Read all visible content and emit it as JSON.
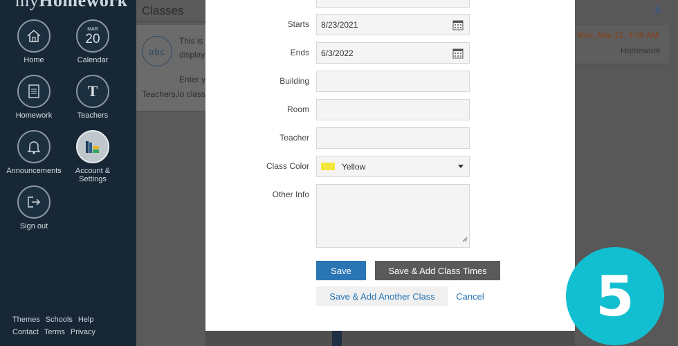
{
  "sidebar": {
    "brand_light": "my",
    "brand_bold": "Homework",
    "nav": [
      {
        "label": "Home",
        "icon": "home-icon"
      },
      {
        "label": "Calendar",
        "icon": "calendar-icon",
        "month": "MAR",
        "day": "20"
      },
      {
        "label": "Homework",
        "icon": "document-icon"
      },
      {
        "label": "Teachers",
        "icon": "teachers-icon"
      },
      {
        "label": "Announcements",
        "icon": "bell-icon"
      },
      {
        "label": "Account & Settings",
        "icon": "books-icon"
      },
      {
        "label": "Sign out",
        "icon": "sign-out-icon"
      }
    ],
    "footer": [
      "Themes",
      "Schools",
      "Help",
      "Contact",
      "Terms",
      "Privacy"
    ]
  },
  "classes_panel": {
    "title": "Classes",
    "avatar_text": "abc",
    "text_line1": "This is",
    "text_line2": "display",
    "text_line3": "Enter y",
    "text_line4": "Teachers.io class"
  },
  "right_panel": {
    "plus": "+",
    "due": "Mon, Mar 21, 9:30 AM",
    "type": "Homework"
  },
  "form": {
    "starts_label": "Starts",
    "starts_value": "8/23/2021",
    "ends_label": "Ends",
    "ends_value": "6/3/2022",
    "building_label": "Building",
    "room_label": "Room",
    "teacher_label": "Teacher",
    "class_color_label": "Class Color",
    "class_color_value": "Yellow",
    "class_color_hex": "#f5e63b",
    "other_info_label": "Other Info"
  },
  "buttons": {
    "save": "Save",
    "save_add_times": "Save & Add Class Times",
    "save_add_another": "Save & Add Another Class",
    "cancel": "Cancel"
  },
  "step_badge": "5",
  "colors": {
    "sidebar_bg": "#172735",
    "primary": "#2a76b4",
    "badge": "#12bfd0"
  }
}
